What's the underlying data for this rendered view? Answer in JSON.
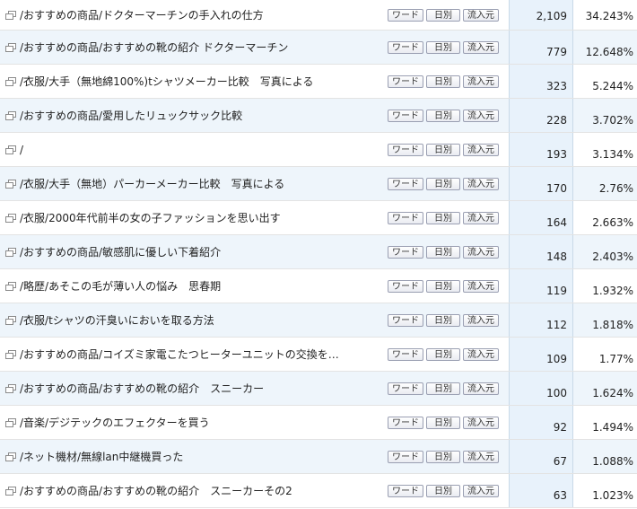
{
  "buttons": {
    "words": "ワード",
    "daily": "日別",
    "source": "流入元"
  },
  "rows": [
    {
      "path": "/おすすめの商品/ドクターマーチンの手入れの仕方",
      "count": "2,109",
      "pct": "34.243%"
    },
    {
      "path": "/おすすめの商品/おすすめの靴の紹介 ドクターマーチン",
      "count": "779",
      "pct": "12.648%"
    },
    {
      "path": "/衣服/大手（無地綿100%)tシャツメーカー比較　写真による",
      "count": "323",
      "pct": "5.244%"
    },
    {
      "path": "/おすすめの商品/愛用したリュックサック比較",
      "count": "228",
      "pct": "3.702%"
    },
    {
      "path": "/",
      "count": "193",
      "pct": "3.134%"
    },
    {
      "path": "/衣服/大手（無地）パーカーメーカー比較　写真による",
      "count": "170",
      "pct": "2.76%"
    },
    {
      "path": "/衣服/2000年代前半の女の子ファッションを思い出す",
      "count": "164",
      "pct": "2.663%"
    },
    {
      "path": "/おすすめの商品/敏感肌に優しい下着紹介",
      "count": "148",
      "pct": "2.403%"
    },
    {
      "path": "/略歴/あそこの毛が薄い人の悩み　思春期",
      "count": "119",
      "pct": "1.932%"
    },
    {
      "path": "/衣服/tシャツの汗臭いにおいを取る方法",
      "count": "112",
      "pct": "1.818%"
    },
    {
      "path": "/おすすめの商品/コイズミ家電こたつヒーターユニットの交換を…",
      "count": "109",
      "pct": "1.77%"
    },
    {
      "path": "/おすすめの商品/おすすめの靴の紹介　スニーカー",
      "count": "100",
      "pct": "1.624%"
    },
    {
      "path": "/音楽/デジテックのエフェクターを買う",
      "count": "92",
      "pct": "1.494%"
    },
    {
      "path": "/ネット機材/無線lan中継機買った",
      "count": "67",
      "pct": "1.088%"
    },
    {
      "path": "/おすすめの商品/おすすめの靴の紹介　スニーカーその2",
      "count": "63",
      "pct": "1.023%"
    }
  ]
}
